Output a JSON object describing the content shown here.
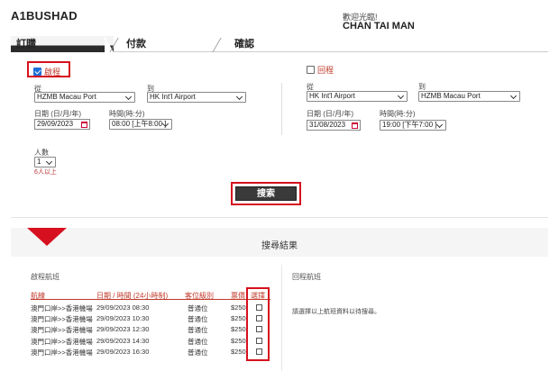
{
  "header": {
    "brand": "A1BUSHAD",
    "welcome": "歡迎光臨!",
    "username": "CHAN TAI MAN"
  },
  "steps": [
    "訂購",
    "付款",
    "確認"
  ],
  "trip": {
    "oneway": {
      "label": "啟程",
      "checked": true
    },
    "return": {
      "label": "回程",
      "checked": false
    }
  },
  "outbound": {
    "from_label": "從",
    "from_value": "HZMB Macau Port",
    "to_label": "到",
    "to_value": "HK Int'l Airport",
    "date_label": "日期 (日/月/年)",
    "date_value": "29/09/2023",
    "time_label": "時間(時:分)",
    "time_value": "08:00 [上午8:00 ]"
  },
  "inbound": {
    "from_label": "從",
    "from_value": "HK Int'l Airport",
    "to_label": "到",
    "to_value": "HZMB Macau Port",
    "date_label": "日期 (日/月/年)",
    "date_value": "31/08/2023",
    "time_label": "時間(時:分)",
    "time_value": "19:00 [下午7:00 ]"
  },
  "passengers": {
    "label": "人數",
    "value": "1",
    "note": "6人以上"
  },
  "search_button": "搜索",
  "results": {
    "title": "搜尋結果",
    "outbound_label": "啟程航班",
    "return_label": "回程航班",
    "return_note": "請選擇以上航班資料以待搜尋。",
    "columns": [
      "航線",
      "日期 / 時間 (24小時制)",
      "客位級別",
      "票價",
      "選擇"
    ],
    "rows": [
      {
        "route": "澳門口岸>>香港機場",
        "datetime": "29/09/2023 08:30",
        "class": "普通位",
        "fare": "$250"
      },
      {
        "route": "澳門口岸>>香港機場",
        "datetime": "29/09/2023 10:30",
        "class": "普通位",
        "fare": "$250"
      },
      {
        "route": "澳門口岸>>香港機場",
        "datetime": "29/09/2023 12:30",
        "class": "普通位",
        "fare": "$250"
      },
      {
        "route": "澳門口岸>>香港機場",
        "datetime": "29/09/2023 14:30",
        "class": "普通位",
        "fare": "$250"
      },
      {
        "route": "澳門口岸>>香港機場",
        "datetime": "29/09/2023 16:30",
        "class": "普通位",
        "fare": "$250"
      }
    ]
  },
  "colors": {
    "accent": "#d6101e",
    "header_text": "#c0392b",
    "dark_button": "#3a3a3a"
  }
}
